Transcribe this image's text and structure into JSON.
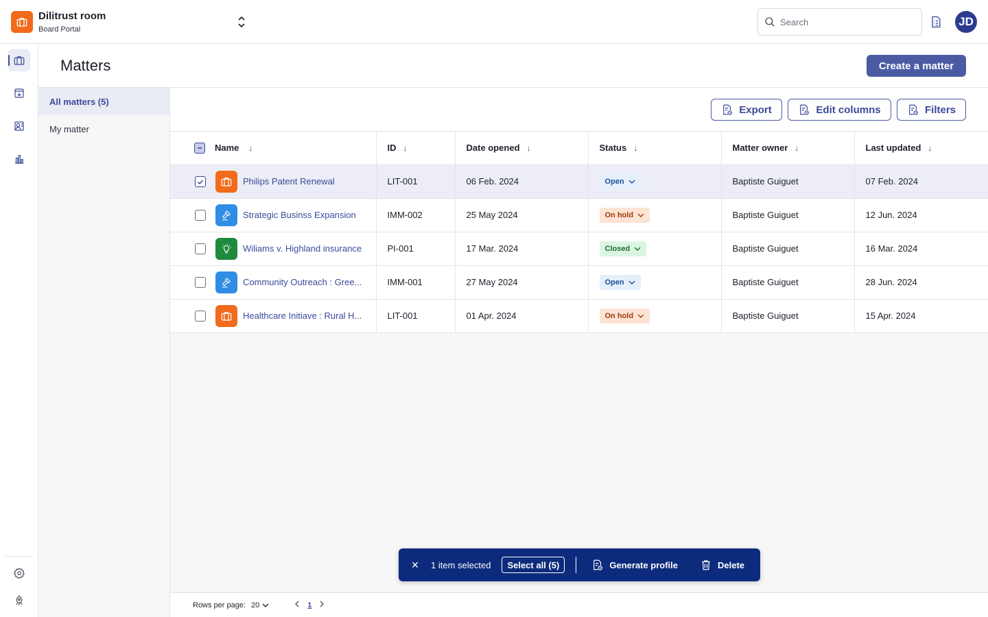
{
  "app": {
    "name": "Dilitrust room",
    "subtitle": "Board Portal",
    "brand_color": "#f26a1b"
  },
  "header": {
    "search_placeholder": "Search",
    "avatar_initials": "JD"
  },
  "page": {
    "title": "Matters",
    "create_label": "Create a matter"
  },
  "views": [
    {
      "label": "All matters (5)",
      "active": true
    },
    {
      "label": "My matter",
      "active": false
    }
  ],
  "toolbar": {
    "export_label": "Export",
    "edit_columns_label": "Edit columns",
    "filters_label": "Filters"
  },
  "table": {
    "columns": [
      "Name",
      "ID",
      "Date opened",
      "Status",
      "Matter owner",
      "Last updated"
    ],
    "rows": [
      {
        "name": "Philips Patent Renewal",
        "id": "LIT-001",
        "date_opened": "06 Feb. 2024",
        "status": "Open",
        "owner": "Baptiste Guiguet",
        "last_updated": "07 Feb. 2024",
        "icon": "briefcase-icon",
        "icon_color": "#f26a1b",
        "selected": true
      },
      {
        "name": "Strategic Businss Expansion",
        "id": "IMM-002",
        "date_opened": "25 May 2024",
        "status": "On hold",
        "owner": "Baptiste Guiguet",
        "last_updated": "12 Jun. 2024",
        "icon": "gavel-icon",
        "icon_color": "#2f8de4",
        "selected": false
      },
      {
        "name": "Wiliams v. Highland insurance",
        "id": "PI-001",
        "date_opened": "17 Mar. 2024",
        "status": "Closed",
        "owner": "Baptiste Guiguet",
        "last_updated": "16 Mar. 2024",
        "icon": "lightbulb-icon",
        "icon_color": "#1e8a3c",
        "selected": false
      },
      {
        "name": "Community Outreach : Gree...",
        "id": "IMM-001",
        "date_opened": "27 May 2024",
        "status": "Open",
        "owner": "Baptiste Guiguet",
        "last_updated": "28 Jun. 2024",
        "icon": "gavel-icon",
        "icon_color": "#2f8de4",
        "selected": false
      },
      {
        "name": "Healthcare Initiave : Rural H...",
        "id": "LIT-001",
        "date_opened": "01 Apr. 2024",
        "status": "On hold",
        "owner": "Baptiste Guiguet",
        "last_updated": "15 Apr. 2024",
        "icon": "briefcase-icon",
        "icon_color": "#f26a1b",
        "selected": false
      }
    ]
  },
  "selection_bar": {
    "count_label": "1 item selected",
    "select_all_label": "Select all (5)",
    "generate_label": "Generate profile",
    "delete_label": "Delete"
  },
  "pagination": {
    "rows_per_page_label": "Rows per page:",
    "rows_per_page_value": "20",
    "current_page": "1"
  }
}
